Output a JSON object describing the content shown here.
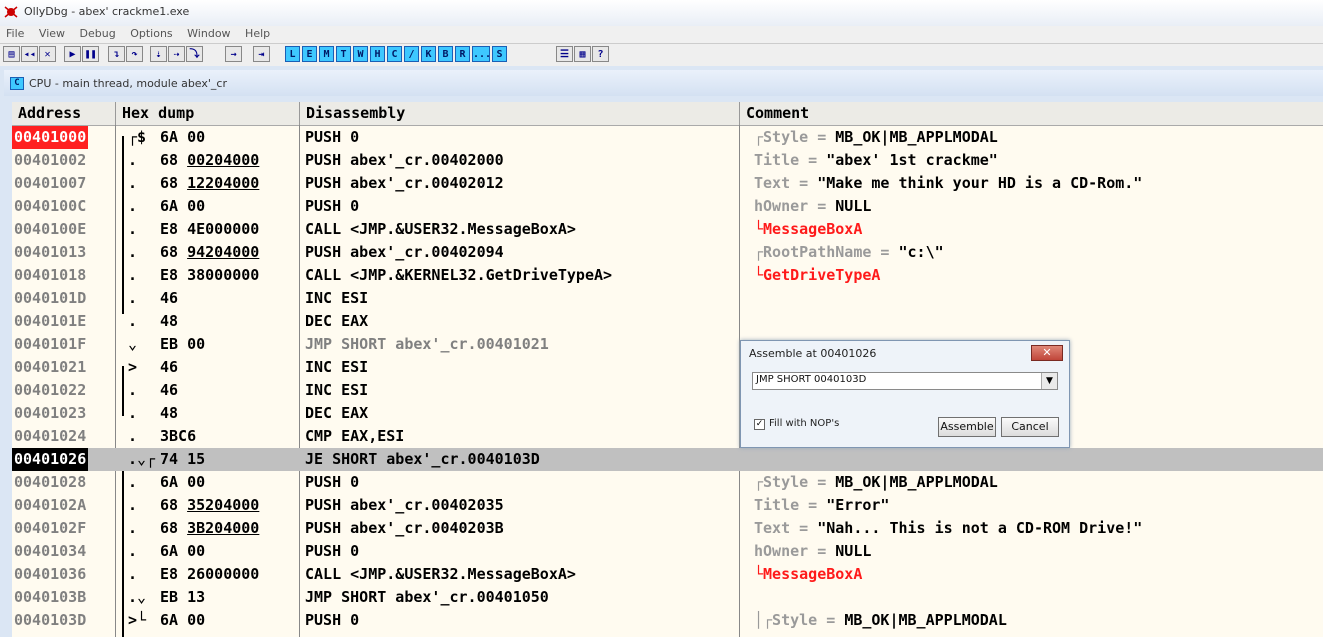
{
  "window": {
    "title": "OllyDbg - abex' crackme1.exe"
  },
  "menu": [
    "File",
    "View",
    "Debug",
    "Options",
    "Window",
    "Help"
  ],
  "toolbar": {
    "letters": [
      "L",
      "E",
      "M",
      "T",
      "W",
      "H",
      "C",
      "/",
      "K",
      "B",
      "R",
      "...",
      "S"
    ]
  },
  "child": {
    "icon": "C",
    "title": "CPU - main thread, module abex'_cr"
  },
  "columns": [
    "Address",
    "Hex dump",
    "Disassembly",
    "Comment"
  ],
  "rows": [
    {
      "addr": "00401000",
      "mark": "┌$",
      "hex_a": "6A 00",
      "hex_u": "",
      "dis": "PUSH 0",
      "ck": "┌Style = ",
      "cv": "MB_OK|MB_APPLMODAL",
      "style": "eip"
    },
    {
      "addr": "00401002",
      "mark": ".",
      "hex_a": "68 ",
      "hex_u": "00204000",
      "dis": "PUSH abex'_cr.00402000",
      "ck": "Title = ",
      "cv": "\"abex' 1st crackme\""
    },
    {
      "addr": "00401007",
      "mark": ".",
      "hex_a": "68 ",
      "hex_u": "12204000",
      "dis": "PUSH abex'_cr.00402012",
      "ck": "Text = ",
      "cv": "\"Make me think your HD is a CD-Rom.\""
    },
    {
      "addr": "0040100C",
      "mark": ".",
      "hex_a": "6A 00",
      "hex_u": "",
      "dis": "PUSH 0",
      "ck": "hOwner = ",
      "cv": "NULL"
    },
    {
      "addr": "0040100E",
      "mark": ".",
      "hex_a": "E8 4E000000",
      "hex_u": "",
      "dis": "CALL <JMP.&USER32.MessageBoxA>",
      "ck": "",
      "cv": "",
      "red": "└MessageBoxA"
    },
    {
      "addr": "00401013",
      "mark": ".",
      "hex_a": "68 ",
      "hex_u": "94204000",
      "dis": "PUSH abex'_cr.00402094",
      "ck": "┌RootPathName = ",
      "cv": "\"c:\\\""
    },
    {
      "addr": "00401018",
      "mark": ".",
      "hex_a": "E8 38000000",
      "hex_u": "",
      "dis": "CALL <JMP.&KERNEL32.GetDriveTypeA>",
      "ck": "",
      "cv": "",
      "red": "└GetDriveTypeA"
    },
    {
      "addr": "0040101D",
      "mark": ".",
      "hex_a": "46",
      "hex_u": "",
      "dis": "INC ESI",
      "ck": "",
      "cv": ""
    },
    {
      "addr": "0040101E",
      "mark": ".",
      "hex_a": "48",
      "hex_u": "",
      "dis": "DEC EAX",
      "ck": "",
      "cv": ""
    },
    {
      "addr": "0040101F",
      "mark": "⌄",
      "hex_a": "EB 00",
      "hex_u": "",
      "dis": "JMP SHORT abex'_cr.00401021",
      "ck": "",
      "cv": "",
      "gray": true
    },
    {
      "addr": "00401021",
      "mark": ">",
      "hex_a": "46",
      "hex_u": "",
      "dis": "INC ESI",
      "ck": "",
      "cv": ""
    },
    {
      "addr": "00401022",
      "mark": ".",
      "hex_a": "46",
      "hex_u": "",
      "dis": "INC ESI",
      "ck": "",
      "cv": ""
    },
    {
      "addr": "00401023",
      "mark": ".",
      "hex_a": "48",
      "hex_u": "",
      "dis": "DEC EAX",
      "ck": "",
      "cv": ""
    },
    {
      "addr": "00401024",
      "mark": ".",
      "hex_a": "3BC6",
      "hex_u": "",
      "dis": "CMP EAX,ESI",
      "ck": "",
      "cv": ""
    },
    {
      "addr": "00401026",
      "mark": ".⌄┌",
      "hex_a": "74 15",
      "hex_u": "",
      "dis": "JE SHORT abex'_cr.0040103D",
      "ck": "",
      "cv": "",
      "style": "cur"
    },
    {
      "addr": "00401028",
      "mark": ".",
      "hex_a": "6A 00",
      "hex_u": "",
      "dis": "PUSH 0",
      "ck": "┌Style = ",
      "cv": "MB_OK|MB_APPLMODAL"
    },
    {
      "addr": "0040102A",
      "mark": ".",
      "hex_a": "68 ",
      "hex_u": "35204000",
      "dis": "PUSH abex'_cr.00402035",
      "ck": "Title = ",
      "cv": "\"Error\""
    },
    {
      "addr": "0040102F",
      "mark": ".",
      "hex_a": "68 ",
      "hex_u": "3B204000",
      "dis": "PUSH abex'_cr.0040203B",
      "ck": "Text = ",
      "cv": "\"Nah... This is not a CD-ROM Drive!\""
    },
    {
      "addr": "00401034",
      "mark": ".",
      "hex_a": "6A 00",
      "hex_u": "",
      "dis": "PUSH 0",
      "ck": "hOwner = ",
      "cv": "NULL"
    },
    {
      "addr": "00401036",
      "mark": ".",
      "hex_a": "E8 26000000",
      "hex_u": "",
      "dis": "CALL <JMP.&USER32.MessageBoxA>",
      "ck": "",
      "cv": "",
      "red": "└MessageBoxA"
    },
    {
      "addr": "0040103B",
      "mark": ".⌄",
      "hex_a": "EB 13",
      "hex_u": "",
      "dis": "JMP SHORT abex'_cr.00401050",
      "ck": "",
      "cv": ""
    },
    {
      "addr": "0040103D",
      "mark": ">└",
      "hex_a": "6A 00",
      "hex_u": "",
      "dis": "PUSH 0",
      "ck": "│┌Style = ",
      "cv": "MB_OK|MB_APPLMODAL"
    }
  ],
  "dialog": {
    "title": "Assemble at 00401026",
    "close": "✕",
    "value": "JMP SHORT 0040103D",
    "checkbox_label": "Fill with NOP's",
    "checked": "✓",
    "assemble": "Assemble",
    "cancel": "Cancel"
  }
}
